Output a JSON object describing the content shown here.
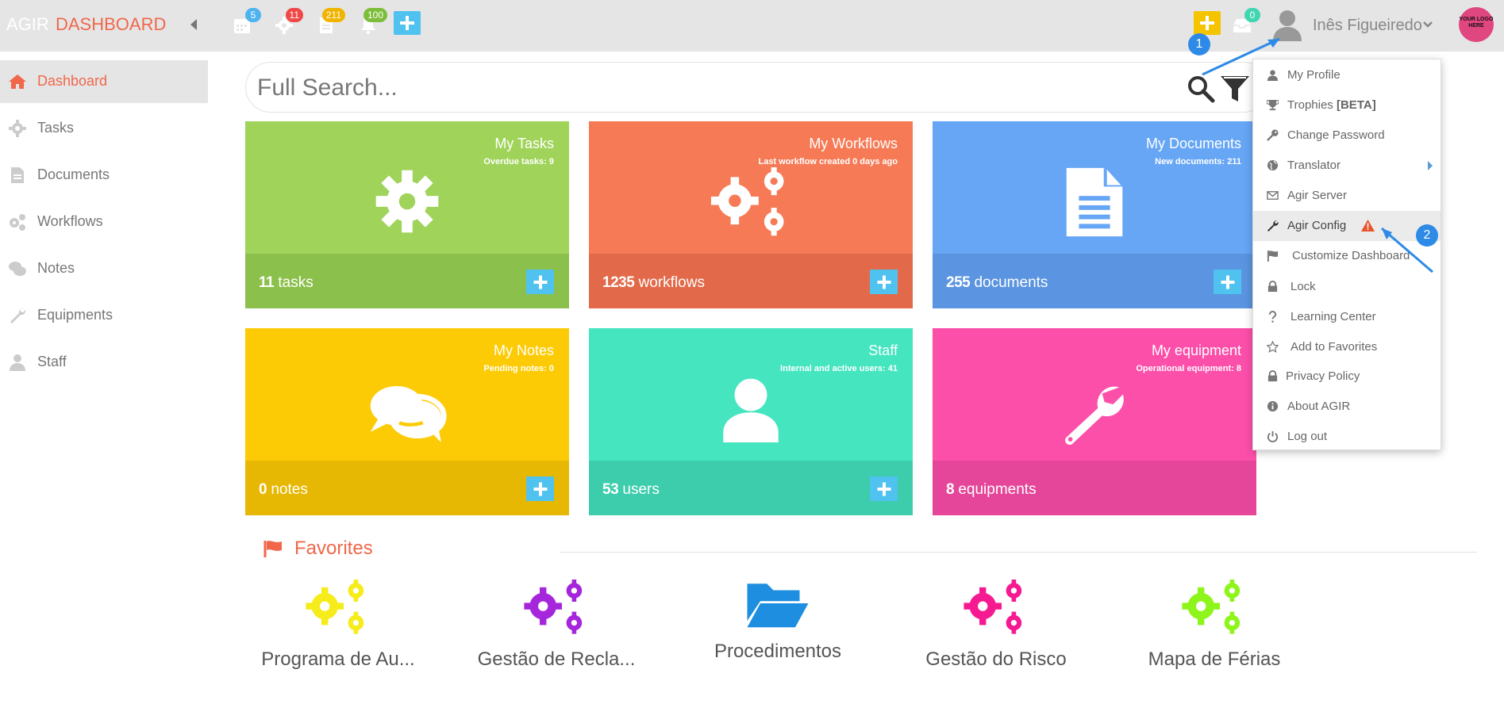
{
  "header": {
    "brand_prefix": "AGIR",
    "brand_title": "DASHBOARD",
    "badges": {
      "calendar": "5",
      "tasks": "11",
      "documents": "211",
      "notifications": "100",
      "inbox": "0"
    },
    "user_name": "Inês Figueiredo",
    "logo_text": "YOUR LOGO HERE"
  },
  "sidebar": {
    "items": [
      {
        "label": "Dashboard",
        "icon": "home-icon"
      },
      {
        "label": "Tasks",
        "icon": "gear-icon"
      },
      {
        "label": "Documents",
        "icon": "document-icon"
      },
      {
        "label": "Workflows",
        "icon": "gears-icon"
      },
      {
        "label": "Notes",
        "icon": "comments-icon"
      },
      {
        "label": "Equipments",
        "icon": "wrench-icon"
      },
      {
        "label": "Staff",
        "icon": "user-icon"
      }
    ]
  },
  "search": {
    "placeholder": "Full Search..."
  },
  "cards": [
    {
      "title": "My Tasks",
      "sub": "Overdue tasks: 9",
      "count": "11",
      "unit": "tasks",
      "color": "#a0d35a",
      "bottom": "#8cc04c"
    },
    {
      "title": "My Workflows",
      "sub": "Last workflow created 0 days ago",
      "count": "1235",
      "unit": "workflows",
      "color": "#f67a55",
      "bottom": "#e26a4a"
    },
    {
      "title": "My Documents",
      "sub": "New documents: 211",
      "count": "255",
      "unit": "documents",
      "color": "#66a6f5",
      "bottom": "#5b94e0"
    },
    {
      "title": "My Notes",
      "sub": "Pending notes: 0",
      "count": "0",
      "unit": "notes",
      "color": "#fccb05",
      "bottom": "#e7b803"
    },
    {
      "title": "Staff",
      "sub": "Internal and active users: 41",
      "count": "53",
      "unit": "users",
      "color": "#45e5c0",
      "bottom": "#3dcdac"
    },
    {
      "title": "My equipment",
      "sub": "Operational equipment: 8",
      "count": "8",
      "unit": "equipments",
      "color": "#fc4faa",
      "bottom": "#e54699"
    }
  ],
  "favorites": {
    "title": "Favorites",
    "items": [
      {
        "label": "Programa de Au...",
        "color": "#f5ec1a"
      },
      {
        "label": "Gestão de Recla...",
        "color": "#a626dc"
      },
      {
        "label": "Procedimentos",
        "color": "#1d8ee0"
      },
      {
        "label": "Gestão do Risco",
        "color": "#f51a91"
      },
      {
        "label": "Mapa de Férias",
        "color": "#8ef51a"
      }
    ]
  },
  "user_menu": {
    "items": [
      {
        "label": "My Profile"
      },
      {
        "label": "Trophies ",
        "bold": "[BETA]"
      },
      {
        "label": "Change Password"
      },
      {
        "label": "Translator"
      },
      {
        "label": "Agir Server"
      },
      {
        "label": "Agir Config"
      },
      {
        "label": "Customize Dashboard"
      },
      {
        "label": "Lock"
      },
      {
        "label": "Learning Center"
      },
      {
        "label": "Add to Favorites"
      },
      {
        "label": "Privacy Policy"
      },
      {
        "label": "About AGIR"
      },
      {
        "label": "Log out"
      }
    ]
  },
  "annotations": {
    "step1": "1",
    "step2": "2"
  }
}
